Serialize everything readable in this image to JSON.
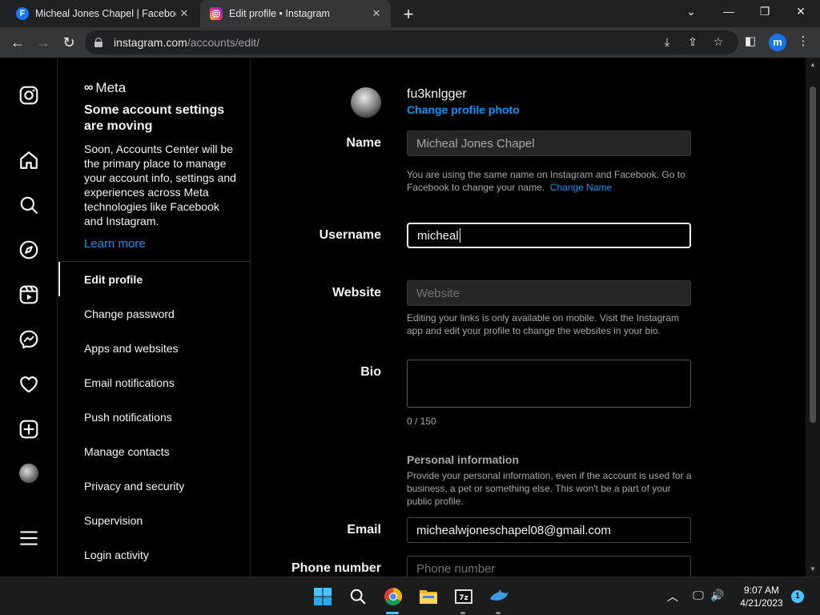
{
  "browser": {
    "tabs": [
      {
        "title": "Micheal Jones Chapel | Facebook",
        "favicon": "F"
      },
      {
        "title": "Edit profile • Instagram"
      }
    ],
    "url_host": "instagram.com",
    "url_path": "/accounts/edit/",
    "profile_initial": "m"
  },
  "sidebar": {
    "meta_logo": "Meta",
    "heading": "Some account settings are moving",
    "description": "Soon, Accounts Center will be the primary place to manage your account info, settings and experiences across Meta technologies like Facebook and Instagram.",
    "learn_more": "Learn more",
    "items": [
      {
        "label": "Edit profile",
        "active": true
      },
      {
        "label": "Change password"
      },
      {
        "label": "Apps and websites"
      },
      {
        "label": "Email notifications"
      },
      {
        "label": "Push notifications"
      },
      {
        "label": "Manage contacts"
      },
      {
        "label": "Privacy and security"
      },
      {
        "label": "Supervision"
      },
      {
        "label": "Login activity"
      }
    ]
  },
  "profile": {
    "username": "fu3knlgger",
    "change_photo": "Change profile photo"
  },
  "form": {
    "name_label": "Name",
    "name_value": "Micheal Jones Chapel",
    "name_hint": "You are using the same name on Instagram and Facebook. Go to Facebook to change your name.",
    "name_hint_link": "Change Name",
    "username_label": "Username",
    "username_value": "micheal",
    "website_label": "Website",
    "website_placeholder": "Website",
    "website_hint": "Editing your links is only available on mobile. Visit the Instagram app and edit your profile to change the websites in your bio.",
    "bio_label": "Bio",
    "bio_count": "0 / 150",
    "personal_title": "Personal information",
    "personal_hint": "Provide your personal information, even if the account is used for a business, a pet or something else. This won't be a part of your public profile.",
    "email_label": "Email",
    "email_value": "michealwjoneschapel08@gmail.com",
    "phone_label": "Phone number",
    "phone_placeholder": "Phone number"
  },
  "taskbar": {
    "time": "9:07 AM",
    "date": "4/21/2023",
    "notifications": "1",
    "apps": [
      "windows-start",
      "search",
      "chrome",
      "file-explorer",
      "7zip",
      "dolphin"
    ]
  }
}
